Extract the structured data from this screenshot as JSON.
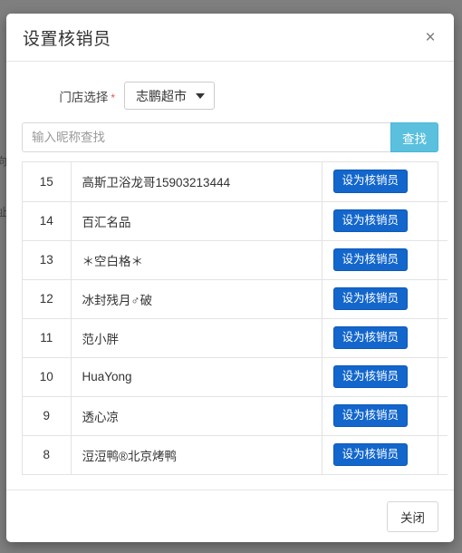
{
  "backdrop": {
    "glyph_top": "向",
    "glyph_bottom": "址"
  },
  "modal": {
    "title": "设置核销员",
    "close_icon_label": "×",
    "form": {
      "store_label": "门店选择",
      "required_mark": "*",
      "store_selected": "志鹏超市",
      "caret_icon": "chevron-down-icon"
    },
    "search": {
      "placeholder": "输入昵称查找",
      "value": "",
      "button_label": "查找"
    },
    "table": {
      "action_label": "设为核销员",
      "rows": [
        {
          "id": "15",
          "name": "高斯卫浴龙哥15903213444"
        },
        {
          "id": "14",
          "name": "百汇名品"
        },
        {
          "id": "13",
          "name": "＊空白格＊"
        },
        {
          "id": "12",
          "name": "冰封残月♂破"
        },
        {
          "id": "11",
          "name": "范小胖"
        },
        {
          "id": "10",
          "name": "HuaYong"
        },
        {
          "id": "9",
          "name": "透心凉"
        },
        {
          "id": "8",
          "name": "浢浢鸭®北京烤鸭"
        }
      ]
    },
    "footer": {
      "close_label": "关闭"
    }
  },
  "colors": {
    "search_button": "#5bc0de",
    "assign_button": "#1266cc",
    "required_star": "#e55353",
    "backdrop": "#808080",
    "border": "#e3e3e3"
  }
}
